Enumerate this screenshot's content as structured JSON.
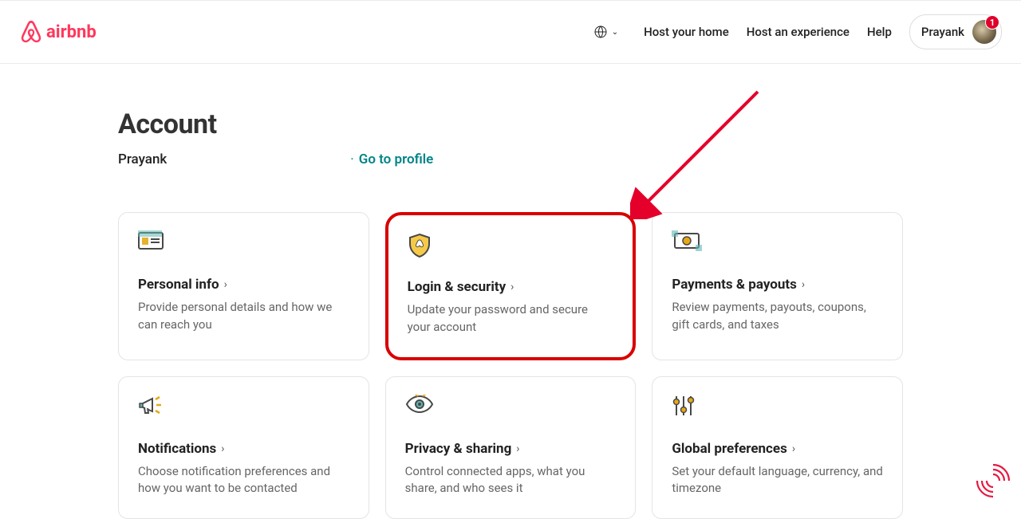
{
  "brand": {
    "name": "airbnb"
  },
  "header": {
    "links": {
      "host_home": "Host your home",
      "host_experience": "Host an experience",
      "help": "Help"
    },
    "user": {
      "name": "Prayank",
      "badge": "1"
    }
  },
  "page": {
    "title": "Account",
    "user_name": "Prayank",
    "go_profile": "Go to profile"
  },
  "cards": [
    {
      "title": "Personal info",
      "desc": "Provide personal details and how we can reach you"
    },
    {
      "title": "Login & security",
      "desc": "Update your password and secure your account"
    },
    {
      "title": "Payments & payouts",
      "desc": "Review payments, payouts, coupons, gift cards, and taxes"
    },
    {
      "title": "Notifications",
      "desc": "Choose notification preferences and how you want to be contacted"
    },
    {
      "title": "Privacy & sharing",
      "desc": "Control connected apps, what you share, and who sees it"
    },
    {
      "title": "Global preferences",
      "desc": "Set your default language, currency, and timezone"
    }
  ]
}
